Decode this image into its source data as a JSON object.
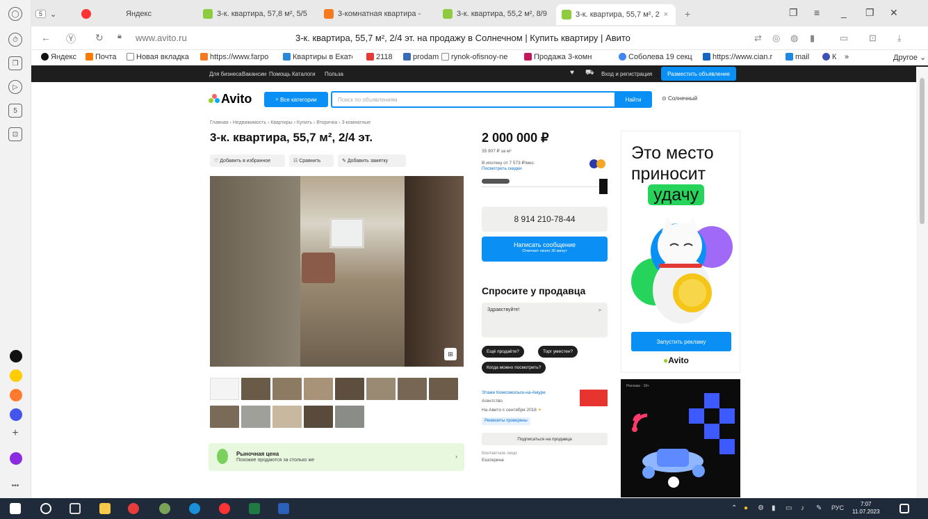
{
  "browser": {
    "tabs": [
      {
        "label": "Яндекс",
        "color": "#ff3333"
      },
      {
        "label": "3-к. квартира, 57,8 м², 5/5",
        "color": "#8ecb3f"
      },
      {
        "label": "3-комнатная квартира -",
        "color": "#f47a20"
      },
      {
        "label": "3-к. квартира, 55,2 м², 8/9",
        "color": "#8ecb3f"
      },
      {
        "label": "3-к. квартира, 55,7 м², 2",
        "color": "#8ecb3f"
      }
    ],
    "tab_count_badge": "5",
    "url": "www.avito.ru",
    "page_title": "3-к. квартира, 55,7 м², 2/4 эт. на продажу в Солнечном | Купить квартиру | Авито",
    "bookmarks": [
      "Яндекс",
      "Почта",
      "Новая вкладка",
      "https://www.farpo",
      "Квартиры в Екате",
      "2118",
      "prodam",
      "rynok-ofisnoy-ne",
      "Продажа 3-комн",
      "Соболева 19 секц",
      "https://www.cian.r",
      "mail",
      "К",
      "»",
      "Другое"
    ]
  },
  "avito_top": {
    "links": [
      "Для бизнеса",
      "Вакансии",
      "Помощь",
      "Каталоги",
      "Польза"
    ],
    "login": "Вход и регистрация",
    "post_ad": "Разместить объявление"
  },
  "search": {
    "logo": "Avito",
    "categories": "Все категории",
    "placeholder": "Поиск по объявлениям",
    "find": "Найти",
    "location": "Солнечный"
  },
  "listing": {
    "breadcrumbs": "Главная › Недвижимость › Квартиры › Купить › Вторичка › 3-комнатные",
    "title": "3-к. квартира, 55,7 м², 2/4 эт.",
    "actions": {
      "favorite": "Добавить в избранное",
      "compare": "Сравнить",
      "note": "Добавить заметку"
    },
    "market": {
      "title": "Рыночная цена",
      "subtitle": "Похожие продаются за столько же"
    }
  },
  "price_block": {
    "price": "2 000 000 ₽",
    "per_m2": "35 907 ₽ за м²",
    "mortgage": "В ипотеку от 7 573 ₽/мес.",
    "discounts": "Посмотреть скидки",
    "phone": "8 914 210-78-44",
    "message_button": "Написать сообщение",
    "message_sub": "Отвечает около 30 минут"
  },
  "ask": {
    "title": "Спросите у продавца",
    "input": "Здравствуйте!",
    "chips": [
      "Ещё продаёте?",
      "Торг уместен?",
      "Когда можно посмотреть?"
    ]
  },
  "seller": {
    "name": "Этажи Комсомольск-на-Амуре",
    "type": "Агентство",
    "since": "На Авито с сентября 2016",
    "verified": "Реквизиты проверены",
    "subscribe": "Подписаться на продавца",
    "contact_label": "Контактное лицо",
    "contact_name": "Екатерина"
  },
  "ad": {
    "headline_1": "Это место",
    "headline_2": "приносит",
    "headline_3": "удачу",
    "cta": "Запустить рекламу",
    "brand": "Avito",
    "ad2_label": "Реклама · 18+"
  },
  "taskbar": {
    "lang": "РУС",
    "time": "7:07",
    "date": "11.07.2023"
  },
  "colors": {
    "accent": "#0a8ff5",
    "green": "#26d45c",
    "dark": "#1e1e1e"
  }
}
